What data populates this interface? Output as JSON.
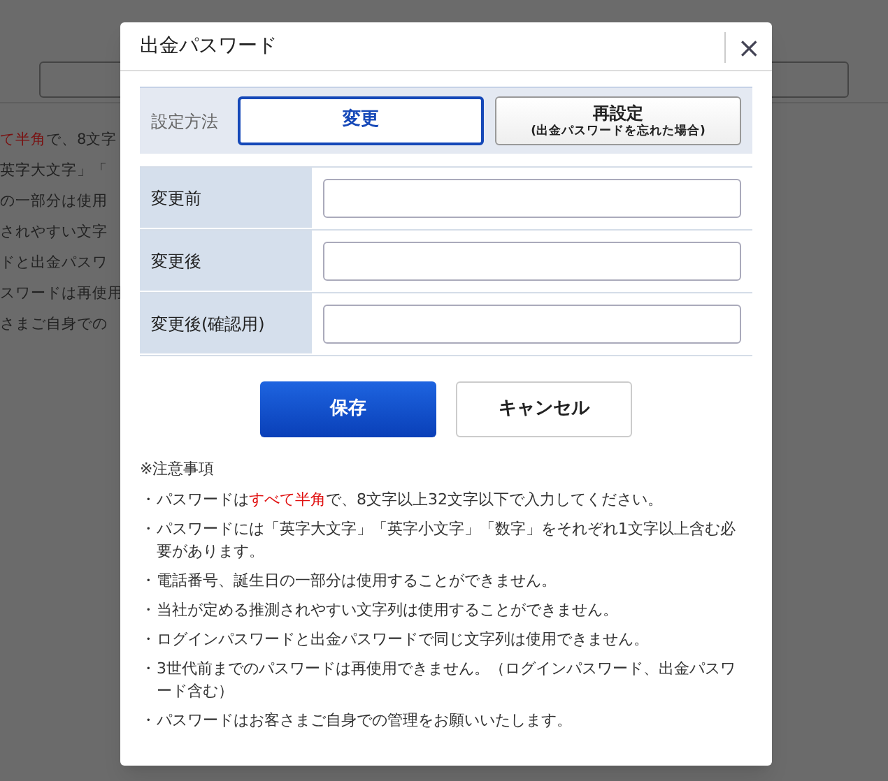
{
  "backdrop": {
    "left_texts": [
      [
        {
          "text": "て半角",
          "emphasis": true
        },
        {
          "text": "で、8文字",
          "emphasis": false
        }
      ],
      [
        {
          "text": "英字大文字」「",
          "emphasis": false
        }
      ],
      [
        {
          "text": "の一部分は使用",
          "emphasis": false
        }
      ],
      [
        {
          "text": "されやすい文字",
          "emphasis": false
        }
      ],
      [
        {
          "text": "ドと出金パスワ",
          "emphasis": false
        }
      ],
      [
        {
          "text": "スワードは再使用",
          "emphasis": false
        }
      ],
      [
        {
          "text": "さまご自身での",
          "emphasis": false
        }
      ]
    ]
  },
  "dialog": {
    "title": "出金パスワード",
    "close": "×",
    "method": {
      "label": "設定方法",
      "options": [
        {
          "label": "変更",
          "selected": true
        },
        {
          "label": "再設定",
          "sub": "(出金パスワードを忘れた場合)",
          "selected": false
        }
      ]
    },
    "fields": [
      {
        "label": "変更前"
      },
      {
        "label": "変更後"
      },
      {
        "label": "変更後(確認用)"
      }
    ],
    "buttons": [
      {
        "label": "保存",
        "kind": "primary"
      },
      {
        "label": "キャンセル",
        "kind": "secondary"
      }
    ],
    "notes_title": "※注意事項",
    "notes": [
      {
        "bullet": "・",
        "segments": [
          {
            "text": "パスワードは",
            "emphasis": false
          },
          {
            "text": "すべて半角",
            "emphasis": true
          },
          {
            "text": "で、8文字以上32文字以下で入力してください。",
            "emphasis": false
          }
        ]
      },
      {
        "bullet": "・",
        "segments": [
          {
            "text": "パスワードには「英字大文字」「英字小文字」「数字」をそれぞれ1文字以上含む必要があります。",
            "emphasis": false
          }
        ]
      },
      {
        "bullet": "・",
        "segments": [
          {
            "text": "電話番号、誕生日の一部分は使用することができません。",
            "emphasis": false
          }
        ]
      },
      {
        "bullet": "・",
        "segments": [
          {
            "text": "当社が定める推測されやすい文字列は使用することができません。",
            "emphasis": false
          }
        ]
      },
      {
        "bullet": "・",
        "segments": [
          {
            "text": "ログインパスワードと出金パスワードで同じ文字列は使用できません。",
            "emphasis": false
          }
        ]
      },
      {
        "bullet": "・",
        "segments": [
          {
            "text": "3世代前までのパスワードは再使用できません。（ログインパスワード、出金パスワード含む）",
            "emphasis": false
          }
        ]
      },
      {
        "bullet": "・",
        "segments": [
          {
            "text": "パスワードはお客さまご自身での管理をお願いいたします。",
            "emphasis": false
          }
        ]
      }
    ]
  }
}
